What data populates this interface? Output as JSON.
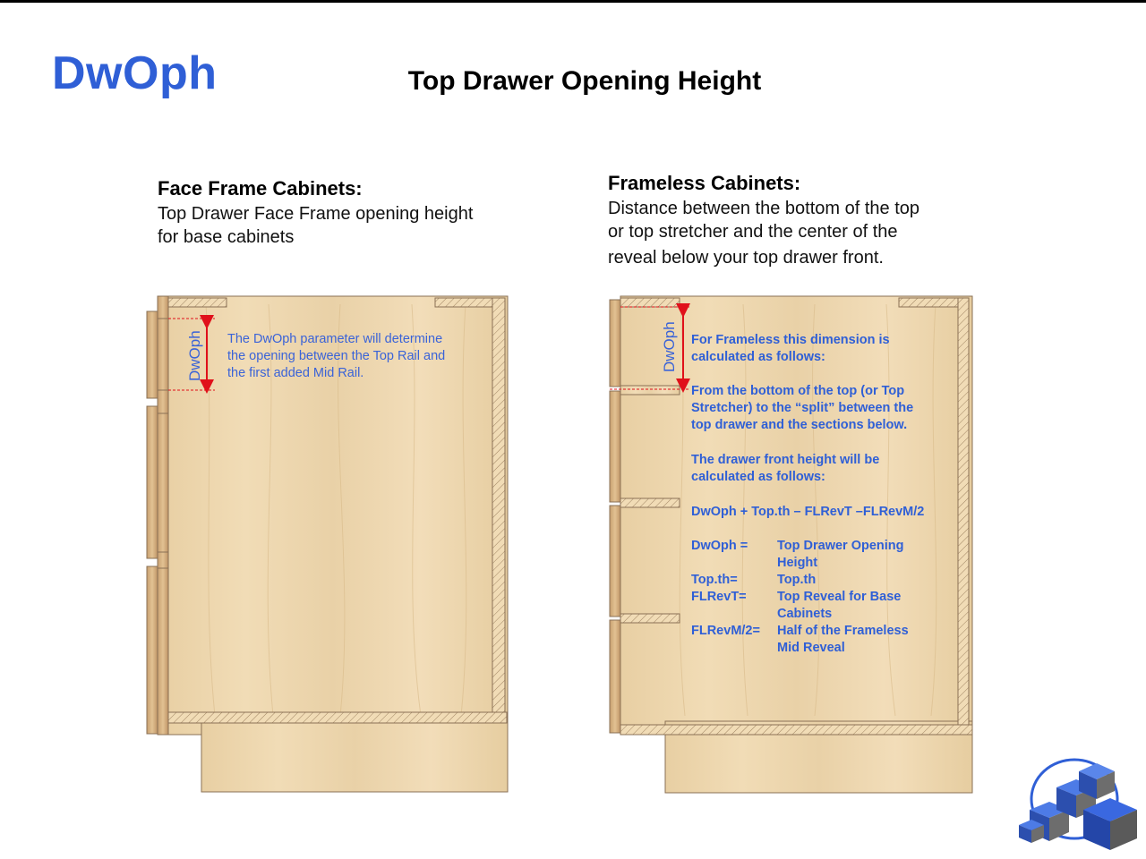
{
  "page": {
    "code": "DwOph",
    "title": "Top Drawer Opening Height"
  },
  "face_frame": {
    "heading": "Face Frame Cabinets:",
    "desc_line1": "Top Drawer Face Frame opening height",
    "desc_line2": "for base cabinets",
    "dim_label": "DwOph",
    "note_line1": "The DwOph parameter will determine",
    "note_line2": "the opening between the Top Rail and",
    "note_line3": "the first added  Mid Rail."
  },
  "frameless": {
    "heading": "Frameless Cabinets:",
    "desc_line1": "Distance between the bottom of the top",
    "desc_line2": "or top stretcher and the center of the",
    "desc_line3": "reveal below your top drawer front.",
    "dim_label": "DwOph",
    "p1_line1": "For Frameless this dimension is",
    "p1_line2": "calculated as follows:",
    "p2_line1": "From the bottom of the top (or Top",
    "p2_line2": "Stretcher) to the “split” between the",
    "p2_line3": "top drawer and the sections below.",
    "p3_line1": "The drawer front height will be",
    "p3_line2": "calculated as follows:",
    "formula": "DwOph + Top.th – FLRevT –FLRevM/2",
    "defs": [
      {
        "term": "DwOph =",
        "line1": "Top Drawer Opening",
        "line2": "Height"
      },
      {
        "term": "Top.th=",
        "line1": "Top.th",
        "line2": ""
      },
      {
        "term": "FLRevT=",
        "line1": "Top Reveal for Base",
        "line2": "Cabinets"
      },
      {
        "term": "FLRevM/2=",
        "line1": "Half of the Frameless",
        "line2": "Mid Reveal"
      }
    ]
  },
  "colors": {
    "accent": "#2f5fd6",
    "dimension": "#e0101a",
    "wood": "#ecd5ac",
    "wood_edge": "#8a7055"
  },
  "logo": {
    "icon": "cubes-logo-icon"
  }
}
